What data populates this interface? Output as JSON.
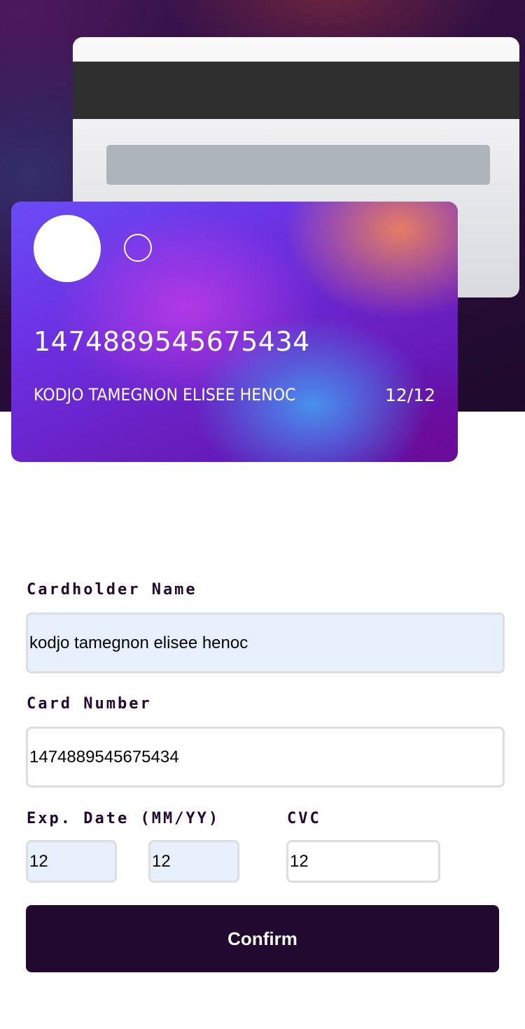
{
  "card_preview": {
    "number": "1474889545675434",
    "holder": "KODJO TAMEGNON ELISEE HENOC",
    "expiry": "12/12"
  },
  "form": {
    "cardholder_name": {
      "label": "Cardholder Name",
      "value": "kodjo tamegnon elisee henoc"
    },
    "card_number": {
      "label": "Card Number",
      "value": "1474889545675434"
    },
    "exp_date": {
      "label": "Exp. Date (MM/YY)",
      "month_value": "12",
      "year_value": "12"
    },
    "cvc": {
      "label": "CVC",
      "value": "12"
    },
    "confirm_label": "Confirm"
  },
  "colors": {
    "accent_dark": "#21092f",
    "field_border": "#dedddf",
    "autofill_background": "#e8f0fe"
  }
}
